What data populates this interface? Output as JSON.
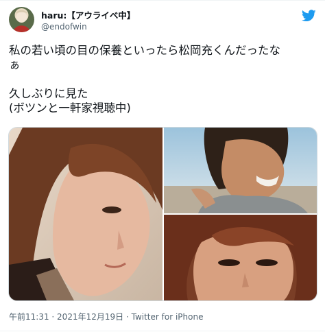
{
  "user": {
    "display_name": "haru:【アウライベ中】",
    "handle": "@endofwin"
  },
  "tweet": {
    "paragraph_1": "私の若い頃の目の保養といったら松岡充くんだったな\nぁ",
    "paragraph_2": "久しぶりに見た\n(ボツンと一軒家視聴中)"
  },
  "media": {
    "photos": [
      "photo-1",
      "photo-2",
      "photo-3"
    ]
  },
  "meta": {
    "time": "午前11:31",
    "separator_1": " · ",
    "date": "2021年12月19日",
    "separator_2": " · ",
    "source": "Twitter for iPhone"
  },
  "colors": {
    "twitter_blue": "#1d9bf0",
    "text": "#0f1419",
    "secondary": "#536471"
  },
  "icons": [
    "avatar",
    "twitter-logo-icon"
  ]
}
